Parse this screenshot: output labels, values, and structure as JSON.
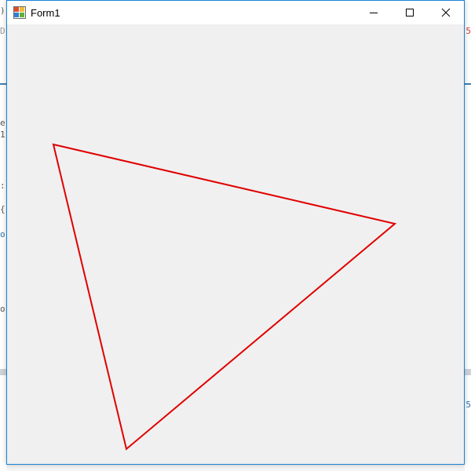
{
  "window": {
    "title": "Form1"
  },
  "controls": {
    "minimize_icon": "minimize-icon",
    "maximize_icon": "maximize-icon",
    "close_icon": "close-icon"
  },
  "canvas": {
    "shape": "triangle",
    "stroke_color": "#e00000",
    "fill": "none"
  },
  "background_fragments": {
    "left": [
      ")",
      "D",
      "e",
      "1",
      ":",
      "{",
      "o",
      "o"
    ],
    "right": [
      "5",
      "5"
    ]
  },
  "colors": {
    "client_background": "#f0f0f0",
    "window_border": "#1883d7",
    "titlebar": "#ffffff"
  }
}
